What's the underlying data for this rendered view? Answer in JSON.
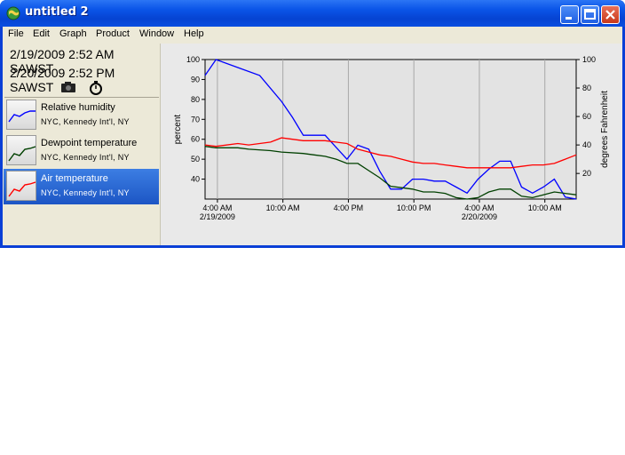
{
  "window": {
    "title": "untitled 2"
  },
  "menu": [
    "File",
    "Edit",
    "Graph",
    "Product",
    "Window",
    "Help"
  ],
  "left_panel": {
    "start_time": "2/19/2009 2:52 AM SAWST",
    "end_time": "2/20/2009 2:52 PM SAWST",
    "tools": [
      "camera-icon",
      "stopwatch-icon"
    ],
    "items": [
      {
        "title": "Relative humidity",
        "location": "NYC, Kennedy Int'l, NY",
        "color": "#0000ff",
        "selected": false
      },
      {
        "title": "Dewpoint temperature",
        "location": "NYC, Kennedy Int'l, NY",
        "color": "#004000",
        "selected": false
      },
      {
        "title": "Air temperature",
        "location": "NYC, Kennedy Int'l, NY",
        "color": "#ff0000",
        "selected": true
      }
    ]
  },
  "chart_data": {
    "type": "line",
    "x_tick_labels": [
      {
        "time": "4:00 AM",
        "date": "2/19/2009"
      },
      {
        "time": "10:00 AM",
        "date": ""
      },
      {
        "time": "4:00 PM",
        "date": ""
      },
      {
        "time": "10:00 PM",
        "date": ""
      },
      {
        "time": "4:00 AM",
        "date": "2/20/2009"
      },
      {
        "time": "10:00 AM",
        "date": ""
      }
    ],
    "x_ticks_hours": [
      1.13,
      7.13,
      13.13,
      19.13,
      25.13,
      31.13
    ],
    "xlim_hours": [
      0,
      34
    ],
    "ylabel_left": "percent",
    "ylabel_right": "degrees Fahrenheit",
    "ylim_left": [
      30,
      100
    ],
    "yticks_left": [
      40,
      50,
      60,
      70,
      80,
      90,
      100
    ],
    "ylim_right": [
      2,
      100
    ],
    "yticks_right": [
      20,
      40,
      60,
      80,
      100
    ],
    "grid": true,
    "series": [
      {
        "name": "Relative humidity",
        "axis": "left",
        "color": "#0000ff",
        "x": [
          0,
          1,
          3,
          5,
          7,
          8,
          9,
          10,
          11,
          12,
          13,
          14,
          15,
          16,
          17,
          18,
          19,
          20,
          21,
          22,
          23,
          24,
          25,
          26,
          27,
          28,
          29,
          30,
          31,
          32,
          33,
          34
        ],
        "y": [
          92,
          100,
          96,
          92,
          79,
          71,
          62,
          62,
          62,
          56,
          50,
          57,
          55,
          44,
          35,
          35,
          40,
          40,
          39,
          39,
          36,
          33,
          40,
          45,
          49,
          49,
          36,
          33,
          36,
          40,
          31,
          30
        ]
      },
      {
        "name": "Dewpoint temperature",
        "axis": "right",
        "color": "#004000",
        "x": [
          0,
          1,
          3,
          4,
          6,
          7,
          9,
          10,
          11,
          12,
          13,
          14,
          15,
          16,
          17,
          18,
          19,
          20,
          21,
          22,
          23,
          24,
          25,
          26,
          27,
          28,
          29,
          30,
          31,
          32,
          33,
          34
        ],
        "y": [
          39,
          38,
          38,
          37,
          36,
          35,
          34,
          33,
          32,
          30,
          27,
          27,
          22,
          17,
          11,
          10,
          9,
          7,
          7,
          6,
          3,
          2,
          3,
          7,
          9,
          9,
          4,
          3,
          5,
          7,
          6,
          5
        ]
      },
      {
        "name": "Air temperature",
        "axis": "right",
        "color": "#ff0000",
        "x": [
          0,
          1,
          3,
          4,
          6,
          7,
          8,
          9,
          10,
          11,
          12,
          13,
          14,
          15,
          16,
          17,
          18,
          19,
          20,
          21,
          22,
          23,
          24,
          25,
          26,
          27,
          28,
          29,
          30,
          31,
          32,
          33,
          34
        ],
        "y": [
          40,
          39,
          41,
          40,
          42,
          45,
          44,
          43,
          43,
          43,
          42,
          41,
          37,
          35,
          33,
          32,
          30,
          28,
          27,
          27,
          26,
          25,
          24,
          24,
          24,
          24,
          24,
          25,
          26,
          26,
          27,
          30,
          33
        ]
      }
    ]
  }
}
